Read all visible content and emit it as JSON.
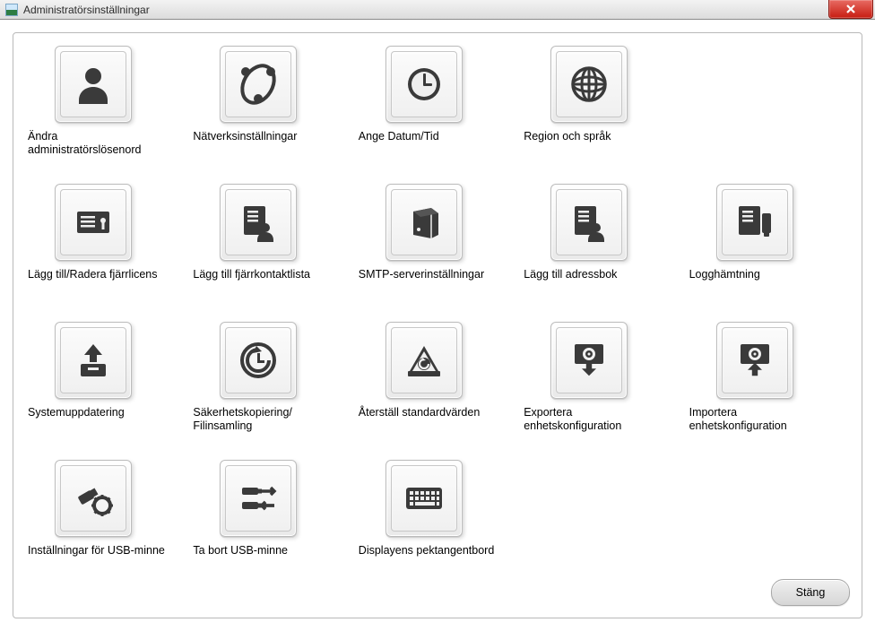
{
  "window": {
    "title": "Administratörsinställningar"
  },
  "buttons": {
    "close_footer": "Stäng"
  },
  "items": [
    {
      "icon": "user",
      "label": "Ändra\nadministratörslösenord"
    },
    {
      "icon": "network",
      "label": "Nätverksinställningar"
    },
    {
      "icon": "clock",
      "label": "Ange Datum/Tid"
    },
    {
      "icon": "globe",
      "label": "Region och språk"
    },
    {
      "icon": "",
      "label": ""
    },
    {
      "icon": "license",
      "label": "Lägg till/Radera fjärrlicens"
    },
    {
      "icon": "contactlist",
      "label": "Lägg till fjärrkontaktlista"
    },
    {
      "icon": "server",
      "label": "SMTP-serverinställningar"
    },
    {
      "icon": "addressbook",
      "label": "Lägg till adressbok"
    },
    {
      "icon": "logfetch",
      "label": "Logghämtning"
    },
    {
      "icon": "update",
      "label": "Systemuppdatering"
    },
    {
      "icon": "backup",
      "label": "Säkerhetskopiering/\nFilinsamling"
    },
    {
      "icon": "restore",
      "label": "Återställ standardvärden"
    },
    {
      "icon": "export",
      "label": "Exportera\nenhetskonfiguration"
    },
    {
      "icon": "import",
      "label": "Importera\nenhetskonfiguration"
    },
    {
      "icon": "usbsettings",
      "label": "Inställningar för USB-minne"
    },
    {
      "icon": "usbeject",
      "label": "Ta bort USB-minne"
    },
    {
      "icon": "keyboard",
      "label": "Displayens pektangentbord"
    },
    {
      "icon": "",
      "label": ""
    },
    {
      "icon": "",
      "label": ""
    }
  ]
}
